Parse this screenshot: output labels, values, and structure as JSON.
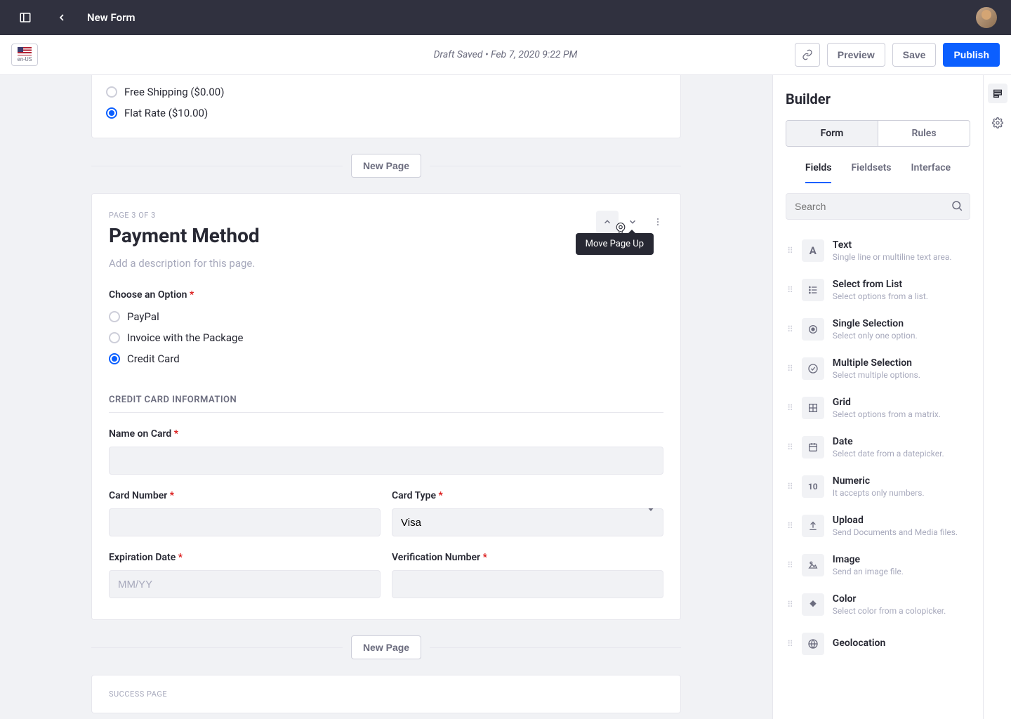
{
  "header": {
    "title": "New Form"
  },
  "toolbar": {
    "locale": "en-US",
    "status": "Draft Saved • Feb 7, 2020 9:22 PM",
    "preview": "Preview",
    "save": "Save",
    "publish": "Publish"
  },
  "shipping": {
    "options": [
      {
        "label": "Free Shipping ($0.00)",
        "checked": false
      },
      {
        "label": "Flat Rate ($10.00)",
        "checked": true
      }
    ]
  },
  "new_page_label": "New Page",
  "page": {
    "meta": "PAGE 3 OF 3",
    "title": "Payment Method",
    "description_placeholder": "Add a description for this page.",
    "tooltip": "Move Page Up",
    "choose_label": "Choose an Option",
    "options": [
      {
        "label": "PayPal",
        "checked": false
      },
      {
        "label": "Invoice with the Package",
        "checked": false
      },
      {
        "label": "Credit Card",
        "checked": true
      }
    ],
    "cc_section": "CREDIT CARD INFORMATION",
    "name_label": "Name on Card",
    "number_label": "Card Number",
    "type_label": "Card Type",
    "type_value": "Visa",
    "exp_label": "Expiration Date",
    "exp_placeholder": "MM/YY",
    "verify_label": "Verification Number"
  },
  "success_meta": "SUCCESS PAGE",
  "builder": {
    "title": "Builder",
    "seg": [
      "Form",
      "Rules"
    ],
    "subtabs": [
      "Fields",
      "Fieldsets",
      "Interface"
    ],
    "search_placeholder": "Search",
    "fields": [
      {
        "icon": "A",
        "name": "Text",
        "desc": "Single line or multiline text area."
      },
      {
        "icon": "list",
        "name": "Select from List",
        "desc": "Select options from a list."
      },
      {
        "icon": "radio",
        "name": "Single Selection",
        "desc": "Select only one option."
      },
      {
        "icon": "check",
        "name": "Multiple Selection",
        "desc": "Select multiple options."
      },
      {
        "icon": "grid",
        "name": "Grid",
        "desc": "Select options from a matrix."
      },
      {
        "icon": "date",
        "name": "Date",
        "desc": "Select date from a datepicker."
      },
      {
        "icon": "10",
        "name": "Numeric",
        "desc": "It accepts only numbers."
      },
      {
        "icon": "upload",
        "name": "Upload",
        "desc": "Send Documents and Media files."
      },
      {
        "icon": "image",
        "name": "Image",
        "desc": "Send an image file."
      },
      {
        "icon": "color",
        "name": "Color",
        "desc": "Select color from a colopicker."
      },
      {
        "icon": "geo",
        "name": "Geolocation",
        "desc": ""
      }
    ]
  }
}
